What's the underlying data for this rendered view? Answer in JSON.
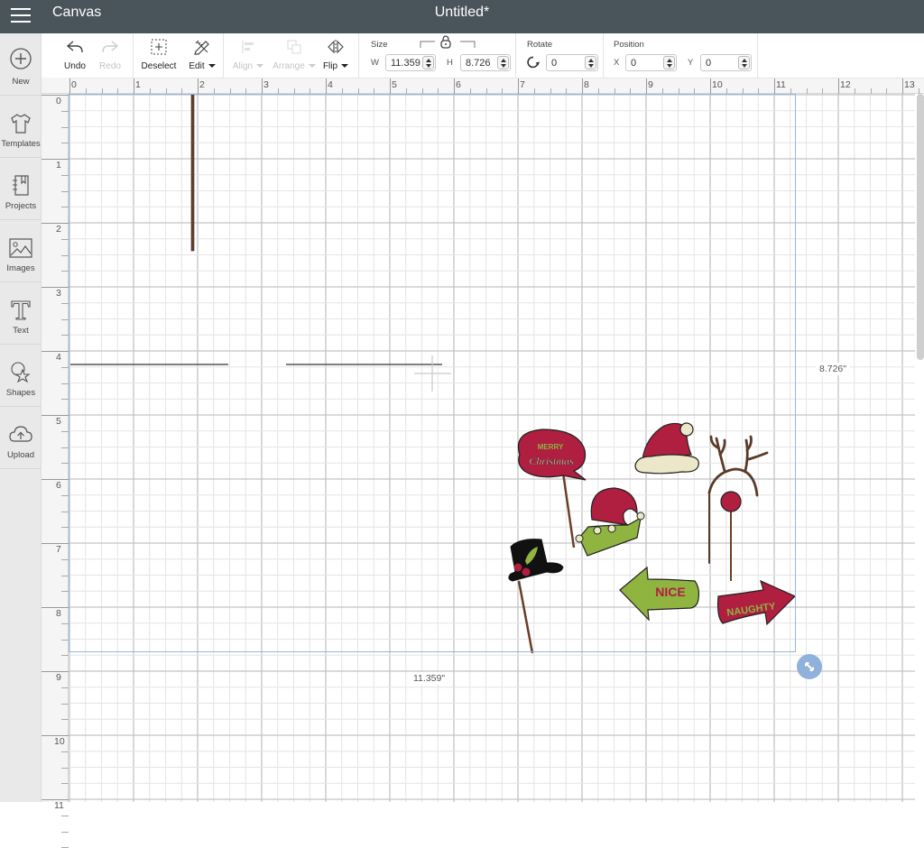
{
  "topbar": {
    "menu_icon": "hamburger-menu-icon",
    "app_title": "Canvas",
    "document_title": "Untitled*"
  },
  "sidebar": {
    "items": [
      {
        "label": "New",
        "icon": "plus-circle-icon"
      },
      {
        "label": "Templates",
        "icon": "tshirt-icon"
      },
      {
        "label": "Projects",
        "icon": "notebook-icon"
      },
      {
        "label": "Images",
        "icon": "image-icon"
      },
      {
        "label": "Text",
        "icon": "text-t-icon"
      },
      {
        "label": "Shapes",
        "icon": "shapes-icon"
      },
      {
        "label": "Upload",
        "icon": "cloud-upload-icon"
      }
    ]
  },
  "toolbar": {
    "undo": {
      "label": "Undo",
      "enabled": true
    },
    "redo": {
      "label": "Redo",
      "enabled": false
    },
    "deselect": {
      "label": "Deselect",
      "enabled": true
    },
    "edit": {
      "label": "Edit",
      "enabled": true
    },
    "align": {
      "label": "Align",
      "enabled": false
    },
    "arrange": {
      "label": "Arrange",
      "enabled": false
    },
    "flip": {
      "label": "Flip",
      "enabled": true
    },
    "size": {
      "label": "Size",
      "w_label": "W",
      "w_value": "11.359",
      "h_label": "H",
      "h_value": "8.726",
      "locked": true
    },
    "rotate": {
      "label": "Rotate",
      "value": "0"
    },
    "position": {
      "label": "Position",
      "x_label": "X",
      "x_value": "0",
      "y_label": "Y",
      "y_value": "0"
    }
  },
  "rulers": {
    "unit": "inch",
    "horizontal": [
      "0",
      "1",
      "2",
      "3",
      "4",
      "5",
      "6",
      "7",
      "8",
      "9",
      "10",
      "11",
      "12",
      "13"
    ],
    "vertical": [
      "0",
      "1",
      "2",
      "3",
      "4",
      "5",
      "6",
      "7",
      "8",
      "9",
      "10",
      "11"
    ]
  },
  "selection": {
    "width_label": "11.359\"",
    "height_label": "8.726\"",
    "width_in": 11.359,
    "height_in": 8.726
  },
  "colors": {
    "topbar": "#4a545b",
    "selection": "#97b8dd",
    "handle": "#8fb1db",
    "red": "#b01e40",
    "green": "#8fb440",
    "cream": "#ece7c9",
    "stick": "#6b3f26"
  },
  "canvas_items": [
    {
      "name": "merry-christmas-speech-bubble",
      "text_top": "MERRY",
      "text_bottom": "Christmas"
    },
    {
      "name": "santa-hat"
    },
    {
      "name": "reindeer-antlers"
    },
    {
      "name": "red-nose"
    },
    {
      "name": "elf-hat"
    },
    {
      "name": "top-hat"
    },
    {
      "name": "nice-arrow-sign",
      "text": "NICE"
    },
    {
      "name": "naughty-arrow-sign",
      "text": "NAUGHTY"
    }
  ]
}
